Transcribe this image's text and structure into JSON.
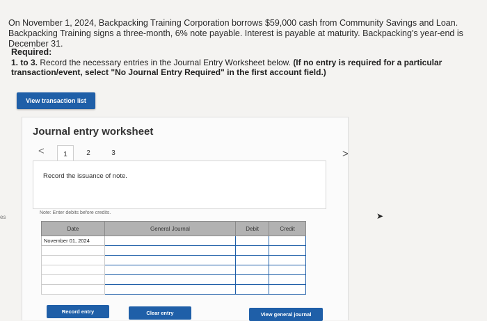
{
  "problem": {
    "text": "On November 1, 2024, Backpacking Training Corporation borrows $59,000 cash from Community Savings and Loan. Backpacking Training signs a three-month, 6% note payable. Interest is payable at maturity. Backpacking's year-end is December 31."
  },
  "required": {
    "heading": "Required:",
    "prefix": "1. to 3.",
    "text": " Record the necessary entries in the Journal Entry Worksheet below. ",
    "bold_note": "(If no entry is required for a particular transaction/event, select \"No Journal Entry Required\" in the first account field.)"
  },
  "side_fragment": "es",
  "view_button": "View transaction list",
  "worksheet": {
    "title": "Journal entry worksheet",
    "nav_prev": "<",
    "nav_next": ">",
    "tabs": [
      "1",
      "2",
      "3"
    ],
    "active_tab": "1",
    "description": "Record the issuance of note.",
    "note": "Note: Enter debits before credits.",
    "columns": [
      "Date",
      "General Journal",
      "Debit",
      "Credit"
    ],
    "rows": [
      {
        "date": "November 01, 2024",
        "account": "",
        "debit": "",
        "credit": ""
      },
      {
        "date": "",
        "account": "",
        "debit": "",
        "credit": ""
      },
      {
        "date": "",
        "account": "",
        "debit": "",
        "credit": ""
      },
      {
        "date": "",
        "account": "",
        "debit": "",
        "credit": ""
      },
      {
        "date": "",
        "account": "",
        "debit": "",
        "credit": ""
      },
      {
        "date": "",
        "account": "",
        "debit": "",
        "credit": ""
      }
    ],
    "buttons": {
      "record": "Record entry",
      "clear": "Clear entry",
      "view_journal": "View general journal"
    }
  },
  "colors": {
    "button_blue": "#1f5fa8",
    "header_gray": "#b2b2b2"
  }
}
